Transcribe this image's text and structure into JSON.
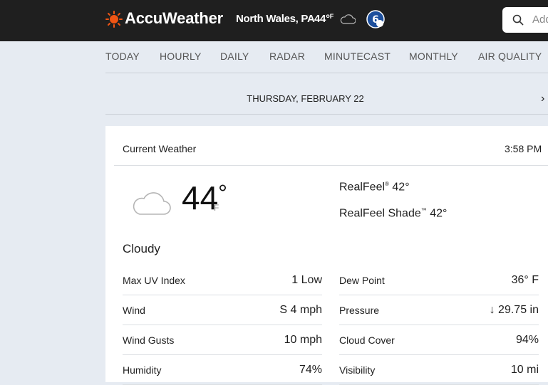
{
  "header": {
    "brand": "AccuWeather",
    "location": "North Wales, PA",
    "temp": "44°",
    "temp_unit": "F",
    "search_placeholder": "Add",
    "icons": [
      "sun-logo-icon",
      "cloud-icon",
      "abc6-logo-icon",
      "search-icon"
    ],
    "colors": {
      "bar": "#1f1f1f",
      "logo_sun": "#f05514"
    }
  },
  "nav": {
    "tabs": [
      "TODAY",
      "HOURLY",
      "DAILY",
      "RADAR",
      "MINUTECAST",
      "MONTHLY",
      "AIR QUALITY"
    ]
  },
  "date": {
    "label": "THURSDAY, FEBRUARY 22",
    "next_icon": "chevron-right-icon"
  },
  "current": {
    "title": "Current Weather",
    "time": "3:58 PM",
    "temp": "44",
    "unit": "F",
    "realfeel_label": "RealFeel",
    "realfeel_value": "42°",
    "realfeel_shade_label": "RealFeel Shade",
    "realfeel_shade_value": "42°",
    "phrase": "Cloudy",
    "details_left": [
      {
        "label": "Max UV Index",
        "value": "1 Low"
      },
      {
        "label": "Wind",
        "value": "S 4 mph"
      },
      {
        "label": "Wind Gusts",
        "value": "10 mph"
      },
      {
        "label": "Humidity",
        "value": "74%"
      }
    ],
    "details_right": [
      {
        "label": "Dew Point",
        "value": "36° F"
      },
      {
        "label": "Pressure",
        "value": "↓ 29.75 in"
      },
      {
        "label": "Cloud Cover",
        "value": "94%"
      },
      {
        "label": "Visibility",
        "value": "10 mi"
      }
    ]
  }
}
